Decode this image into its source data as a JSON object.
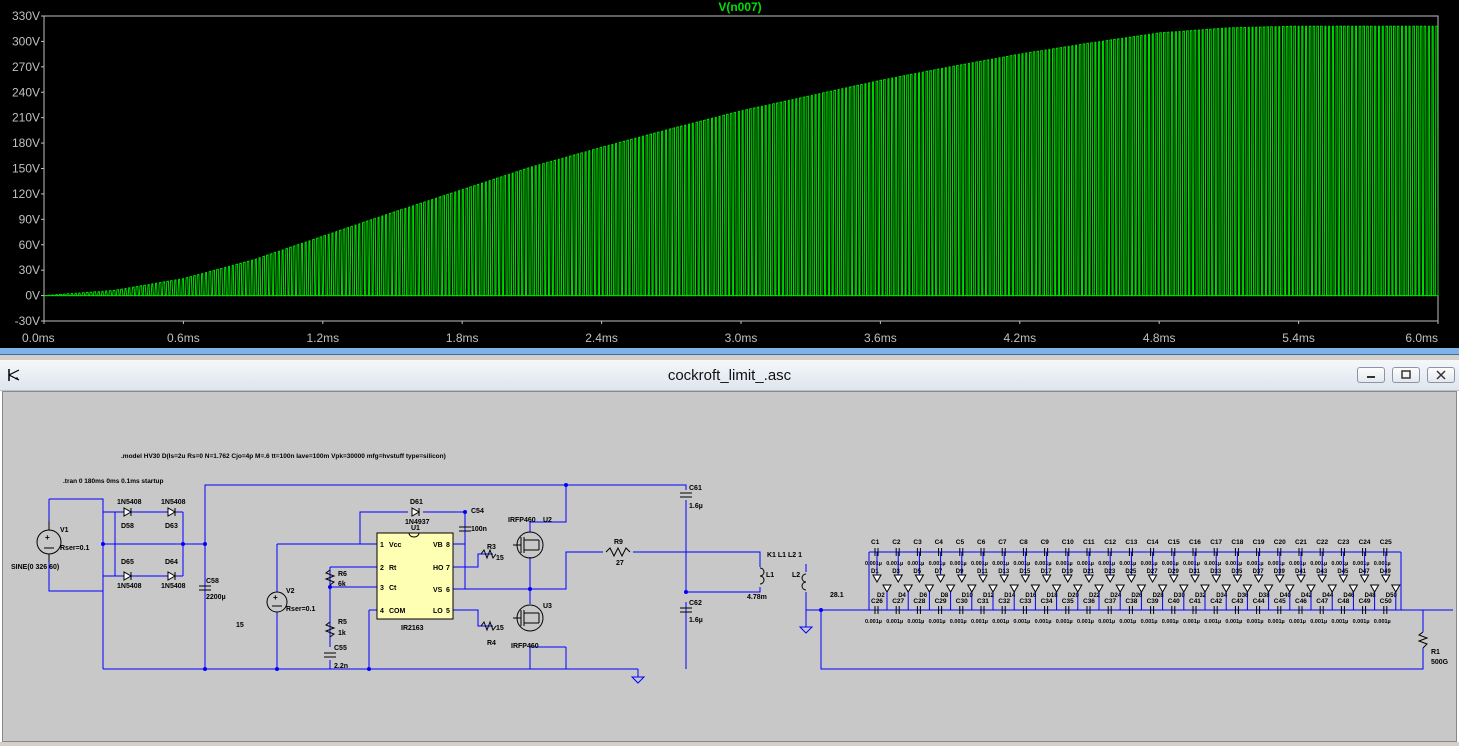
{
  "plot": {
    "trace_label": "V(n007)",
    "trace_color": "#00e000",
    "axis_color": "#c0c0c0",
    "chart_data": {
      "type": "line",
      "title": "V(n007)",
      "xlabel": "",
      "ylabel": "",
      "xlim": [
        0,
        6.0
      ],
      "ylim": [
        -30,
        330
      ],
      "x_unit": "ms",
      "y_unit": "V",
      "y_ticks": [
        "330V",
        "300V",
        "270V",
        "240V",
        "210V",
        "180V",
        "150V",
        "120V",
        "90V",
        "60V",
        "30V",
        "0V",
        "-30V"
      ],
      "x_ticks": [
        "0.0ms",
        "0.6ms",
        "1.2ms",
        "1.8ms",
        "2.4ms",
        "3.0ms",
        "3.6ms",
        "4.2ms",
        "4.8ms",
        "5.4ms",
        "6.0ms"
      ],
      "series": [
        {
          "name": "V(n007)",
          "envelope_peak": {
            "x": [
              0.0,
              0.3,
              0.6,
              0.9,
              1.2,
              1.5,
              1.8,
              2.1,
              2.4,
              2.7,
              3.0,
              3.3,
              3.6,
              3.9,
              4.2,
              4.5,
              4.8,
              5.1,
              5.4,
              5.7,
              6.0
            ],
            "y": [
              0,
              6,
              20,
              42,
              70,
              98,
              125,
              152,
              175,
              197,
              218,
              236,
              254,
              270,
              285,
              298,
              310,
              316,
              318,
              318,
              318
            ]
          },
          "min_value": 0
        }
      ]
    }
  },
  "schematic": {
    "title": "cockroft_limit_.asc",
    "model_directive": ".model HV30 D(Is=2u Rs=0 N=1.762 Cjo=4p M=.6 tt=100n Iave=100m Vpk=30000 mfg=hvstuff type=silicon)",
    "tran_directive": ".tran 0 180ms 0ms 0.1ms startup",
    "v1": {
      "name": "V1",
      "rser": "Rser=0.1",
      "value": "SINE(0 326 60)"
    },
    "v2": {
      "name": "V2",
      "rser": "Rser=0.1",
      "value": "15"
    },
    "bridge": {
      "d58": "D58",
      "d63": "D63",
      "d65": "D65",
      "d64": "D64",
      "model": "1N5408"
    },
    "c58": {
      "name": "C58",
      "value": "2200µ"
    },
    "d61": {
      "name": "D61",
      "model": "1N4937"
    },
    "u1": {
      "name": "U1",
      "model": "IR2163",
      "pins": {
        "p1": "1",
        "p2": "2",
        "p3": "3",
        "p4": "4",
        "p5": "5",
        "p6": "6",
        "p7": "7",
        "p8": "8"
      },
      "labels": {
        "vcc": "Vcc",
        "rt": "Rt",
        "ct": "Ct",
        "com": "COM",
        "vb": "VB",
        "ho": "HO",
        "vs": "VS",
        "lo": "LO"
      }
    },
    "r6": {
      "name": "R6",
      "value": "6k"
    },
    "r5": {
      "name": "R5",
      "value": "1k"
    },
    "c55": {
      "name": "C55",
      "value": "2.2n"
    },
    "c54": {
      "name": "C54",
      "value": "100n"
    },
    "r3": {
      "name": "R3",
      "value": "15"
    },
    "r4": {
      "name": "R4",
      "value": "15"
    },
    "u2": {
      "name": "U2",
      "model": "IRFP460"
    },
    "u3": {
      "name": "U3",
      "model": "IRFP460"
    },
    "r9": {
      "name": "R9",
      "value": "27"
    },
    "c61": {
      "name": "C61",
      "value": "1.6µ"
    },
    "c62": {
      "name": "C62",
      "value": "1.6µ"
    },
    "l1": {
      "name": "L1",
      "value": "4.78m"
    },
    "l2": {
      "name": "L2",
      "value": "28.1"
    },
    "coupling": "K1 L1 L2 1",
    "r1": {
      "name": "R1",
      "value": "500G"
    },
    "ladder": {
      "top_caps": [
        "C1",
        "C2",
        "C3",
        "C4",
        "C5",
        "C6",
        "C7",
        "C8",
        "C9",
        "C10",
        "C11",
        "C12",
        "C13",
        "C14",
        "C15",
        "C16",
        "C17",
        "C18",
        "C19",
        "C20",
        "C21",
        "C22",
        "C23",
        "C24",
        "C25"
      ],
      "bottom_caps": [
        "C26",
        "C27",
        "C28",
        "C29",
        "C30",
        "C31",
        "C32",
        "C33",
        "C34",
        "C35",
        "C36",
        "C37",
        "C38",
        "C39",
        "C40",
        "C41",
        "C42",
        "C43",
        "C44",
        "C45",
        "C46",
        "C47",
        "C48",
        "C49",
        "C50"
      ],
      "diodes_top": [
        "D1",
        "D3",
        "D5",
        "D7",
        "D9",
        "D11",
        "D13",
        "D15",
        "D17",
        "D19",
        "D21",
        "D23",
        "D25",
        "D27",
        "D29",
        "D31",
        "D33",
        "D35",
        "D37",
        "D39",
        "D41",
        "D43",
        "D45",
        "D47",
        "D49"
      ],
      "diodes_bottom": [
        "D2",
        "D4",
        "D6",
        "D8",
        "D10",
        "D12",
        "D14",
        "D16",
        "D18",
        "D20",
        "D22",
        "D24",
        "D26",
        "D28",
        "D30",
        "D32",
        "D34",
        "D36",
        "D38",
        "D40",
        "D42",
        "D44",
        "D46",
        "D48",
        "D50"
      ],
      "cap_value": "0.001µ"
    }
  }
}
